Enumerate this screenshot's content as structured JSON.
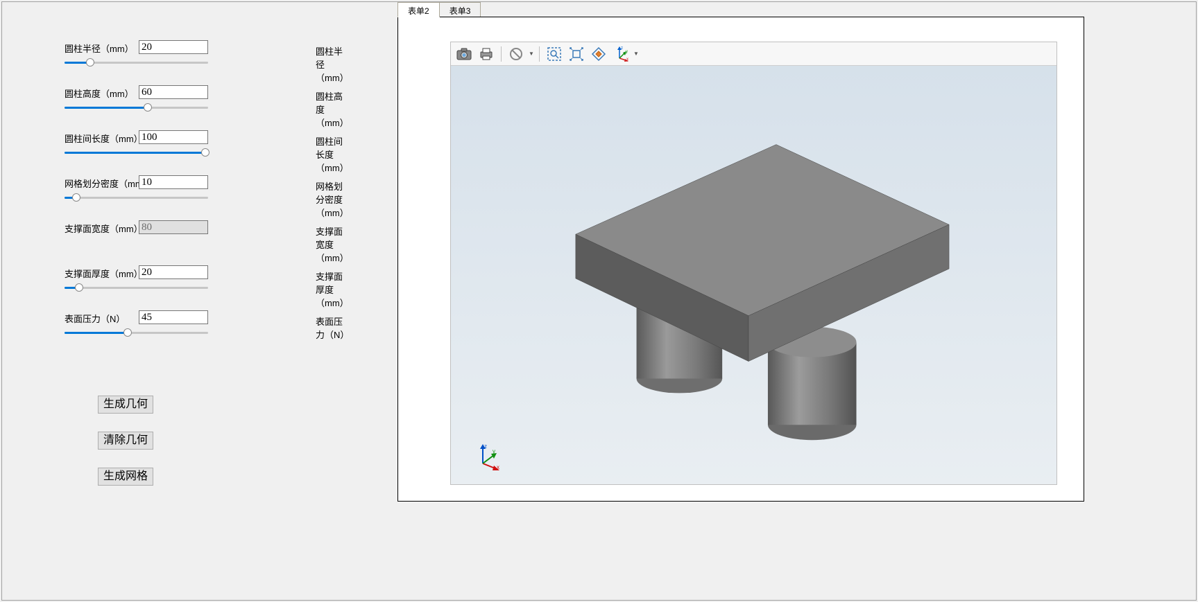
{
  "tabs": {
    "tab1": "表单2",
    "tab2": "表单3"
  },
  "params": [
    {
      "label": "圆柱半径（mm）",
      "value": "20",
      "mirror": "圆柱半径（mm）",
      "slider_percent": 18,
      "disabled": false
    },
    {
      "label": "圆柱高度（mm）",
      "value": "60",
      "mirror": "圆柱高度（mm）",
      "slider_percent": 58,
      "disabled": false
    },
    {
      "label": "圆柱间长度（mm）",
      "value": "100",
      "mirror": "圆柱间长度（mm）",
      "slider_percent": 98,
      "disabled": false
    },
    {
      "label": "网格划分密度（mm）",
      "value": "10",
      "mirror": "网格划分密度（mm）",
      "slider_percent": 8,
      "disabled": false
    },
    {
      "label": "支撑面宽度（mm）",
      "value": "80",
      "mirror": "支撑面宽度（mm）",
      "slider_percent": 0,
      "disabled": true,
      "no_slider": true
    },
    {
      "label": "支撑面厚度（mm）",
      "value": "20",
      "mirror": "支撑面厚度（mm）",
      "slider_percent": 10,
      "disabled": false
    },
    {
      "label": "表面压力（N）",
      "value": "45",
      "mirror": "表面压力（N）",
      "slider_percent": 44,
      "disabled": false
    }
  ],
  "buttons": {
    "generate_geom": "生成几何",
    "clear_geom": "清除几何",
    "generate_mesh": "生成网格"
  },
  "toolbar_axis_labels": {
    "x": "x",
    "y": "y",
    "z": "z"
  },
  "triad_labels": {
    "x": "x",
    "y": "y",
    "z": "z"
  }
}
